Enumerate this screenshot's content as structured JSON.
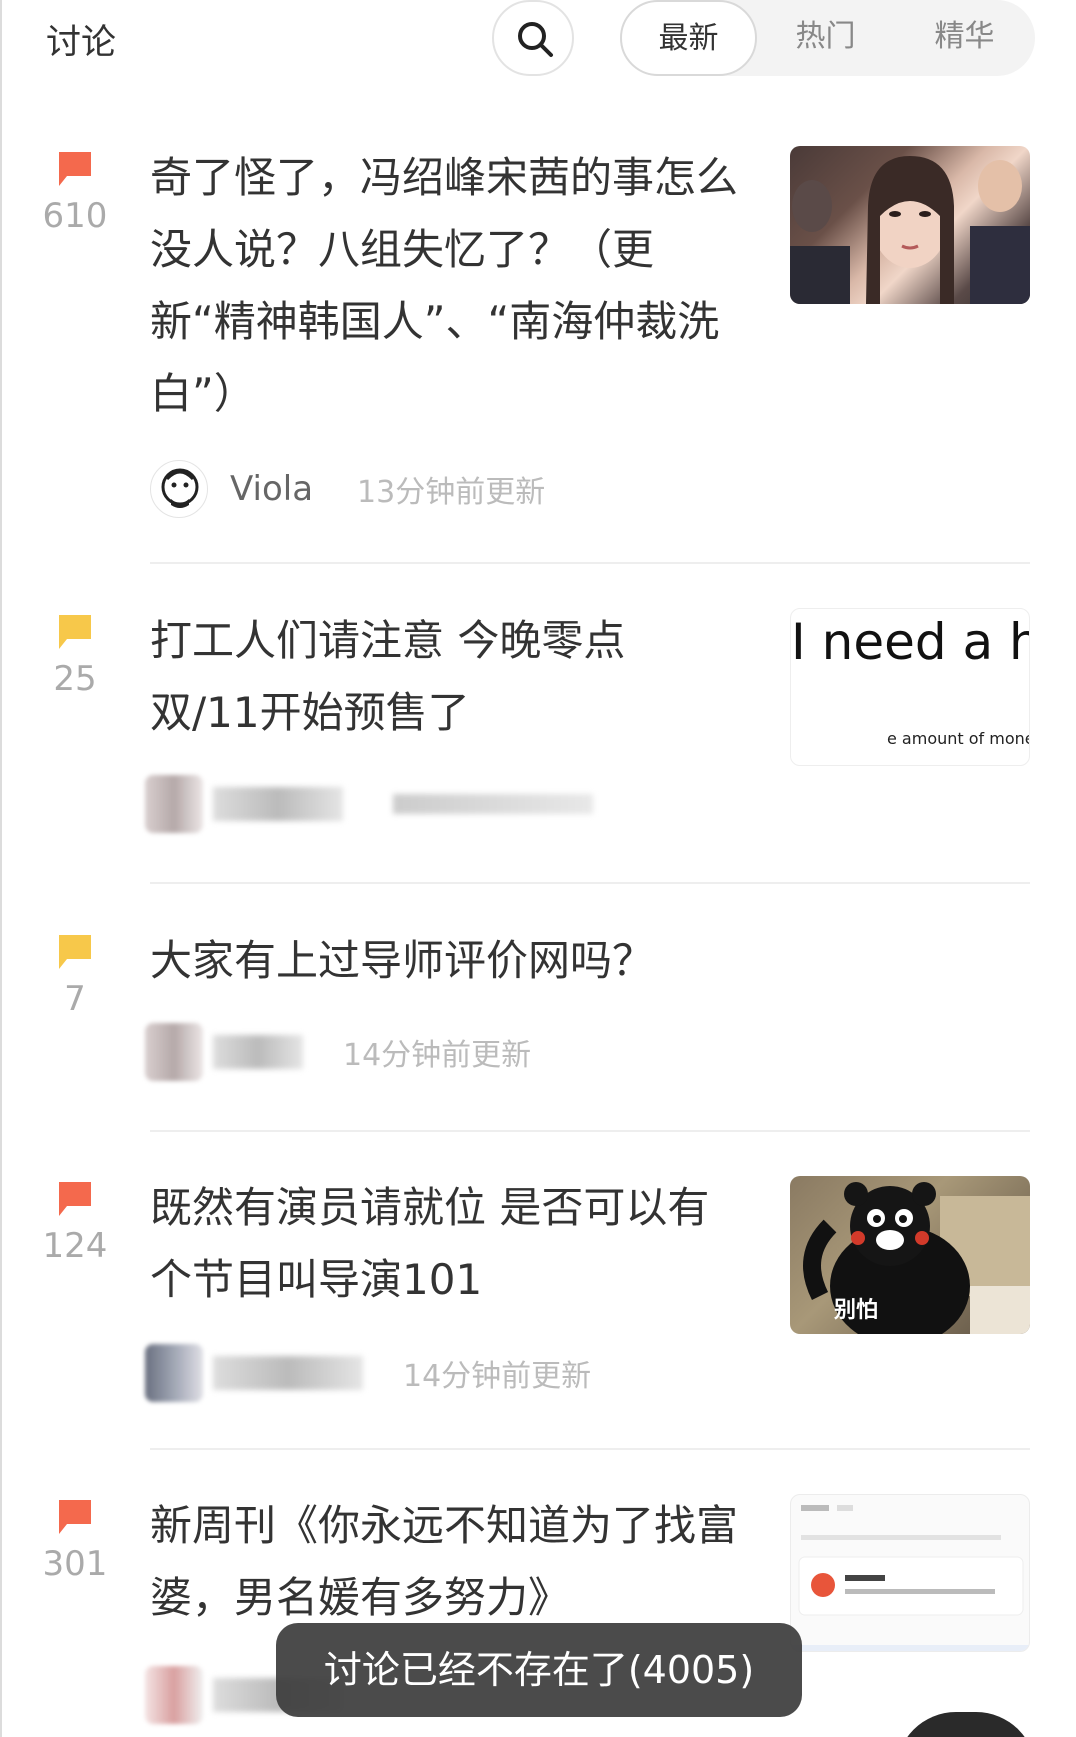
{
  "header": {
    "title": "讨论",
    "search_icon": "search-icon",
    "tabs": [
      {
        "label": "最新",
        "active": true
      },
      {
        "label": "热门",
        "active": false
      },
      {
        "label": "精华",
        "active": false
      }
    ]
  },
  "posts": [
    {
      "count": "610",
      "flag_color": "#f4694d",
      "title": "奇了怪了，冯绍峰宋茜的事怎么没人说？八组失忆了？（更新“精神韩国人”、“南海仲裁洗白”）",
      "author": "Viola",
      "time": "13分钟前更新",
      "thumbnail": "photo-woman-audience"
    },
    {
      "count": "25",
      "flag_color": "#f7c84a",
      "title": "打工人们请注意 今晚零点双/11开始预售了",
      "author": "",
      "time": "",
      "thumbnail_text_main": "I need a hug",
      "thumbnail_text_small": "e amount of money"
    },
    {
      "count": "7",
      "flag_color": "#f7c84a",
      "title": "大家有上过导师评价网吗？",
      "author": "",
      "time": "14分钟前更新"
    },
    {
      "count": "124",
      "flag_color": "#f4694d",
      "title": "既然有演员请就位 是否可以有个节目叫导演101",
      "author": "",
      "time": "14分钟前更新",
      "thumbnail_caption": "别怕"
    },
    {
      "count": "301",
      "flag_color": "#f4694d",
      "title": "新周刊《你永远不知道为了找富婆，男名媛有多努力》",
      "author": "",
      "time": "",
      "thumbnail": "screenshot-xinzhoukan"
    }
  ],
  "toast": "讨论已经不存在了(4005)"
}
